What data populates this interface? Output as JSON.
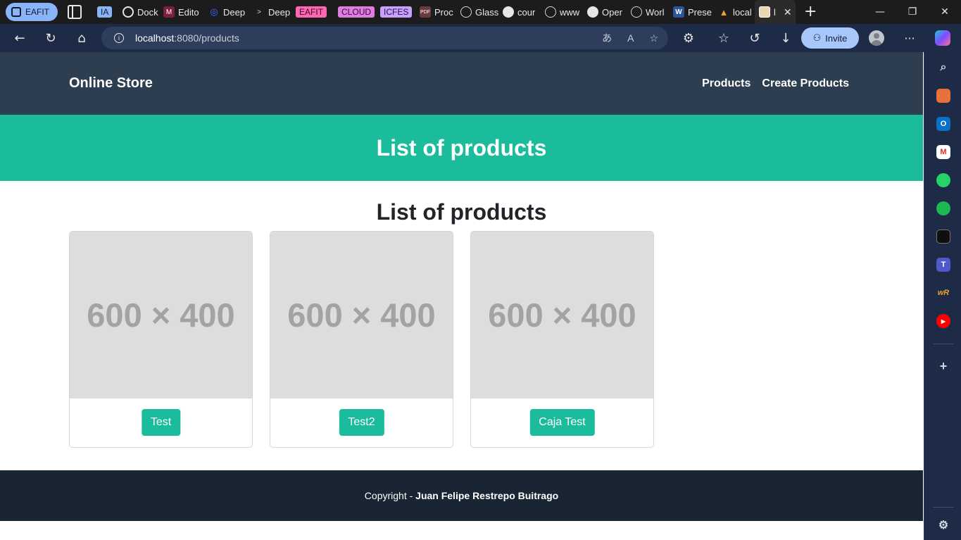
{
  "browser": {
    "profile_label": "EAFIT",
    "tabs": [
      {
        "label": "IA",
        "chip": true,
        "chip_color": "#8ab4f8",
        "icon": "ia-chip-icon"
      },
      {
        "label": "Dock",
        "icon": "chatgpt-icon"
      },
      {
        "label": "Edito",
        "icon": "m-logo-icon"
      },
      {
        "label": "Deep",
        "icon": "deepseek-icon"
      },
      {
        "label": "Deep",
        "icon": "terminal-icon"
      },
      {
        "label": "EAFIT",
        "chip": true,
        "chip_color": "#ff66b3",
        "icon": "eafit-chip-icon"
      },
      {
        "label": "CLOUD",
        "chip": true,
        "chip_color": "#e07ce0",
        "icon": "cloud-chip-icon"
      },
      {
        "label": "ICFES",
        "chip": true,
        "chip_color": "#c9a0ff",
        "icon": "icfes-chip-icon"
      },
      {
        "label": "Proc",
        "icon": "pdf-icon"
      },
      {
        "label": "Glass",
        "icon": "globe-icon"
      },
      {
        "label": "cour",
        "icon": "github-icon"
      },
      {
        "label": "www",
        "icon": "globe-icon"
      },
      {
        "label": "Oper",
        "icon": "github-icon"
      },
      {
        "label": "Worl",
        "icon": "globe-icon"
      },
      {
        "label": "Prese",
        "icon": "word-icon"
      },
      {
        "label": "local",
        "icon": "localhost-icon"
      },
      {
        "label": "l",
        "icon": "image-icon",
        "active": true
      }
    ],
    "url_host": "localhost",
    "url_path": ":8080/products",
    "invite_label": "Invite"
  },
  "site": {
    "brand": "Online Store",
    "nav": {
      "products": "Products",
      "create_products": "Create Products"
    },
    "hero_title": "List of products",
    "section_title": "List of products",
    "products": [
      {
        "placeholder": "600 × 400",
        "name": "Test"
      },
      {
        "placeholder": "600 × 400",
        "name": "Test2"
      },
      {
        "placeholder": "600 × 400",
        "name": "Caja Test"
      }
    ],
    "footer": {
      "prefix": "Copyright - ",
      "author": "Juan Felipe Restrepo Buitrago"
    }
  },
  "colors": {
    "navbar": "#2c3e50",
    "accent": "#1abc9c",
    "footer": "#1a2533",
    "placeholder_bg": "#dddddd"
  }
}
